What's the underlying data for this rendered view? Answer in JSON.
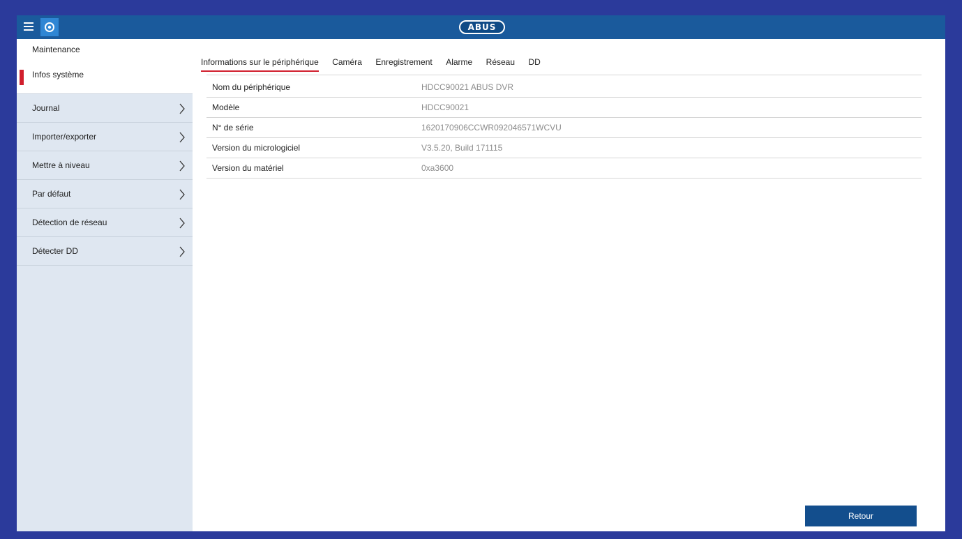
{
  "header": {
    "logo_text": "ABUS",
    "brand_color": "#1a5a9c",
    "menu_icon": "hamburger-icon",
    "settings_icon": "gear-icon"
  },
  "sidebar": {
    "title": "Maintenance",
    "items": [
      {
        "label": "Infos système",
        "active": true
      },
      {
        "label": "Journal"
      },
      {
        "label": "Importer/exporter"
      },
      {
        "label": "Mettre à niveau"
      },
      {
        "label": "Par défaut"
      },
      {
        "label": "Détection de réseau"
      },
      {
        "label": "Détecter DD"
      }
    ]
  },
  "tabs": [
    {
      "label": "Informations sur le périphérique",
      "active": true
    },
    {
      "label": "Caméra"
    },
    {
      "label": "Enregistrement"
    },
    {
      "label": "Alarme"
    },
    {
      "label": "Réseau"
    },
    {
      "label": "DD"
    }
  ],
  "device_info": {
    "rows": [
      {
        "label": "Nom du périphérique",
        "value": "HDCC90021 ABUS DVR"
      },
      {
        "label": "Modèle",
        "value": "HDCC90021"
      },
      {
        "label": "N° de série",
        "value": "1620170906CCWR092046571WCVU"
      },
      {
        "label": "Version du micrologiciel",
        "value": "V3.5.20, Build 171115"
      },
      {
        "label": "Version du matériel",
        "value": "0xa3600"
      }
    ]
  },
  "footer": {
    "back_label": "Retour"
  },
  "colors": {
    "accent": "#d11f2d",
    "button": "#134e8d",
    "sidebar_bg": "#dfe7f1"
  }
}
